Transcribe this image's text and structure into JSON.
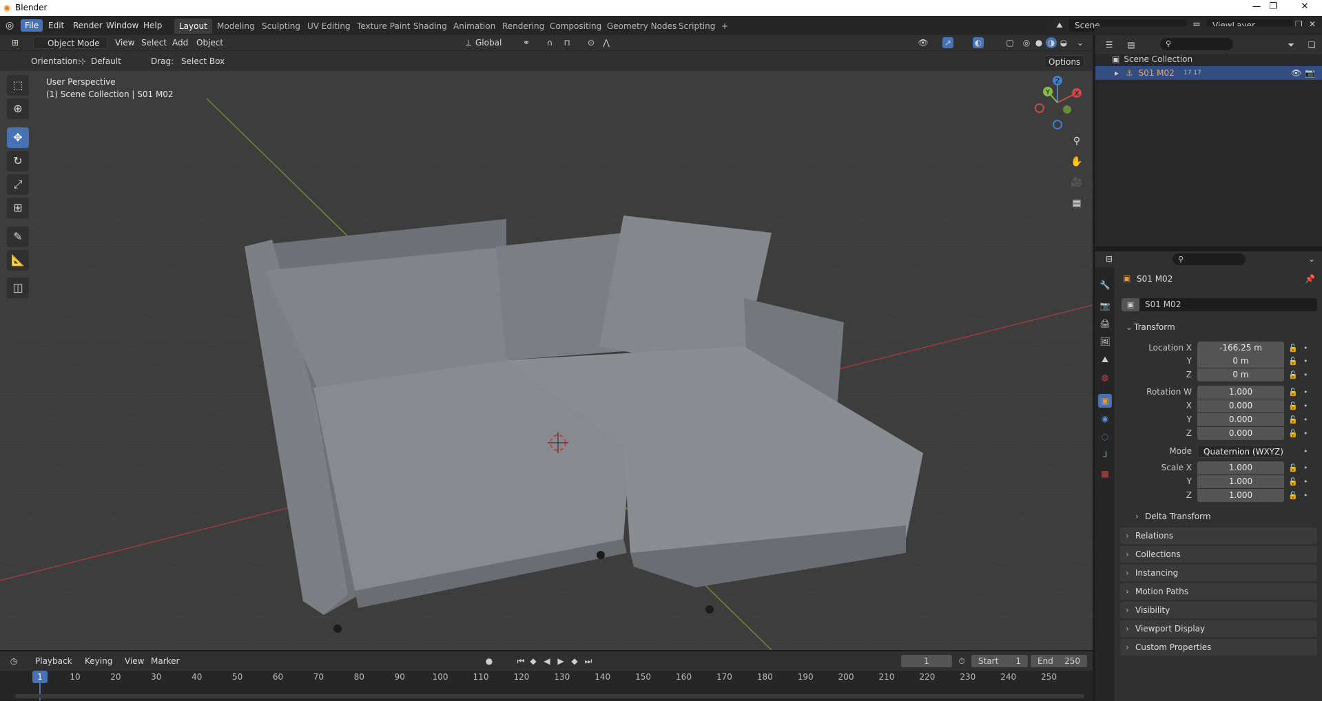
{
  "window": {
    "title": "Blender",
    "minimize": "—",
    "maximize": "❐",
    "close": "✕"
  },
  "menu": {
    "items": [
      "File",
      "Edit",
      "Render",
      "Window",
      "Help"
    ]
  },
  "workspaces": [
    "Layout",
    "Modeling",
    "Sculpting",
    "UV Editing",
    "Texture Paint",
    "Shading",
    "Animation",
    "Rendering",
    "Compositing",
    "Geometry Nodes",
    "Scripting"
  ],
  "topright": {
    "scene": "Scene",
    "view_layer": "ViewLayer"
  },
  "viewport_header": {
    "mode": "Object Mode",
    "view": "View",
    "select": "Select",
    "add": "Add",
    "object": "Object",
    "transform_orientation": "Global"
  },
  "tool_settings": {
    "orientation_label": "Orientation:",
    "orientation_value": "Default",
    "drag_label": "Drag:",
    "drag_value": "Select Box",
    "options": "Options"
  },
  "viewport": {
    "view_name": "User Perspective",
    "collection_info": "(1) Scene Collection | S01 M02"
  },
  "gizmo": {
    "x": "X",
    "y": "Y",
    "z": "Z"
  },
  "outliner": {
    "root": "Scene Collection",
    "object": "S01 M02",
    "counts": "17 17"
  },
  "properties": {
    "object_name": "S01 M02",
    "data_name": "S01 M02",
    "transform_title": "Transform",
    "location_x_label": "Location X",
    "location_x": "-166.25 m",
    "y_label": "Y",
    "z_label": "Z",
    "x_label": "X",
    "w_label": "Rotation W",
    "location_y": "0 m",
    "location_z": "0 m",
    "rotation_w": "1.000",
    "rotation_x": "0.000",
    "rotation_y": "0.000",
    "rotation_z": "0.000",
    "mode_label": "Mode",
    "mode_value": "Quaternion (WXYZ)",
    "scale_x_label": "Scale X",
    "scale_x": "1.000",
    "scale_y": "1.000",
    "scale_z": "1.000",
    "delta_transform": "Delta Transform",
    "panels": [
      "Relations",
      "Collections",
      "Instancing",
      "Motion Paths",
      "Visibility",
      "Viewport Display",
      "Custom Properties"
    ]
  },
  "timeline": {
    "playback": "Playback",
    "keying": "Keying",
    "view": "View",
    "marker": "Marker",
    "current_frame": "1",
    "start_label": "Start",
    "start": "1",
    "end_label": "End",
    "end": "250",
    "ticks": [
      "1",
      "10",
      "20",
      "30",
      "40",
      "50",
      "60",
      "70",
      "80",
      "90",
      "100",
      "110",
      "120",
      "130",
      "140",
      "150",
      "160",
      "170",
      "180",
      "190",
      "200",
      "210",
      "220",
      "230",
      "240",
      "250"
    ]
  },
  "colors": {
    "accent": "#4772b3",
    "x_axis": "#c94a4a",
    "y_axis": "#8ab84a",
    "z_axis": "#3f7fd6",
    "sofa": "#7d8185"
  }
}
